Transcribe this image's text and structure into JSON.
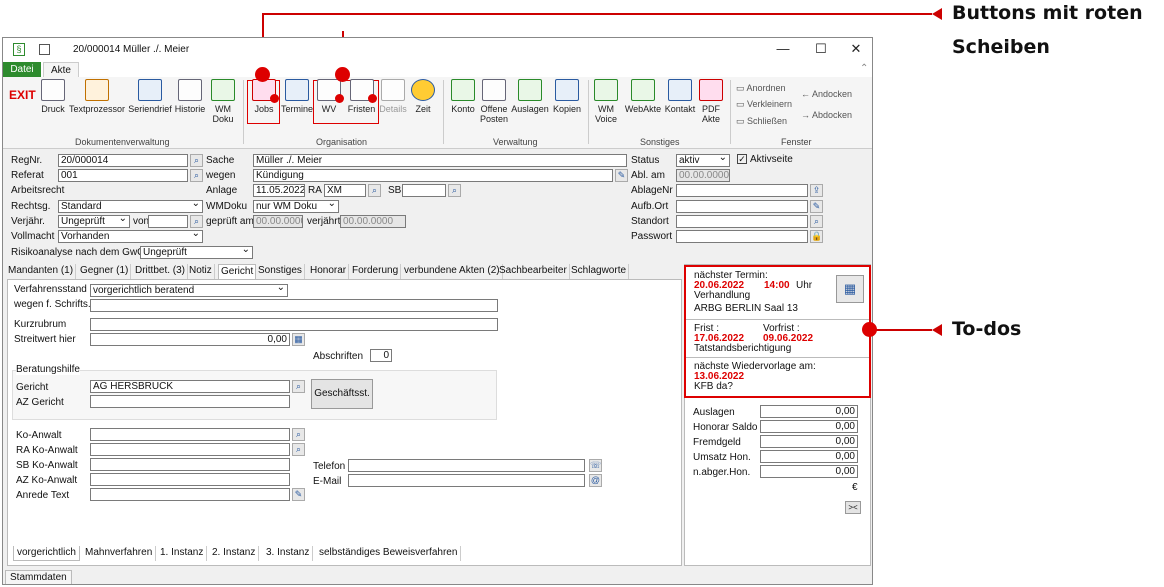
{
  "window": {
    "title": "20/000014 Müller ./. Meier",
    "minimize": "—",
    "maximize": "☐",
    "close": "✕",
    "collapse": "⌃"
  },
  "menu_tabs": {
    "datei": "Datei",
    "akte": "Akte"
  },
  "ribbon": {
    "exit": "EXIT",
    "buttons": [
      {
        "label": "Druck"
      },
      {
        "label": "Textprozessor"
      },
      {
        "label": "Seriendrief"
      },
      {
        "label": "Historie"
      },
      {
        "label": "WM\nDoku"
      },
      {
        "label": "Jobs"
      },
      {
        "label": "Termine"
      },
      {
        "label": "WV"
      },
      {
        "label": "Fristen"
      },
      {
        "label": "Details"
      },
      {
        "label": "Zeit"
      },
      {
        "label": "Konto"
      },
      {
        "label": "Offene\nPosten"
      },
      {
        "label": "Auslagen"
      },
      {
        "label": "Kopien"
      },
      {
        "label": "WM\nVoice"
      },
      {
        "label": "WebAkte"
      },
      {
        "label": "Kontakt"
      },
      {
        "label": "PDF\nAkte"
      }
    ],
    "groups": {
      "dokumentenverwaltung": "Dokumentenverwaltung",
      "organisation": "Organisation",
      "verwaltung": "Verwaltung",
      "sonstiges": "Sonstiges",
      "fenster": "Fenster"
    },
    "fenster": {
      "anordnen": "Anordnen",
      "verkleinern": "Verkleinern",
      "schliessen": "Schließen",
      "andocken": "Andocken",
      "abdocken": "Abdocken"
    }
  },
  "form": {
    "regnr_label": "RegNr.",
    "regnr": "20/000014",
    "referat_label": "Referat",
    "referat": "001",
    "arbeitsrecht_label": "Arbeitsrecht",
    "rechtsg_label": "Rechtsg.",
    "rechtsg": "Standard",
    "verjahr_label": "Verjähr.",
    "verjahr": "Ungeprüft",
    "von_label": "von",
    "vollmacht_label": "Vollmacht",
    "vollmacht": "Vorhanden",
    "risiko_label": "Risikoanalyse nach dem GwG",
    "risiko": "Ungeprüft",
    "sache_label": "Sache",
    "sache": "Müller ./. Meier",
    "wegen_label": "wegen",
    "wegen": "Kündigung",
    "anlage_label": "Anlage",
    "anlage": "11.05.2022",
    "ra_label": "RA",
    "ra": "XM",
    "sb_label": "SB",
    "wmdoku_label": "WMDoku",
    "wmdoku": "nur WM Doku",
    "gepruft_label": "geprüft am",
    "gepruft": "00.00.0000",
    "verjahrt_label": "verjährt",
    "verjahrt": "00.00.0000",
    "status_label": "Status",
    "status": "aktiv",
    "aktivseite": "Aktivseite",
    "ablam_label": "Abl. am",
    "ablam": "00.00.0000",
    "ablagenr_label": "AblageNr",
    "aufbort_label": "Aufb.Ort",
    "standort_label": "Standort",
    "passwort_label": "Passwort"
  },
  "tabs": [
    "Mandanten (1)",
    "Gegner (1)",
    "Drittbet. (3)",
    "Notiz",
    "Gericht",
    "Sonstiges",
    "Honorar",
    "Forderung",
    "verbundene Akten (2)",
    "Sachbearbeiter",
    "Schlagworte"
  ],
  "gericht": {
    "verfahrensstand_label": "Verfahrensstand",
    "verfahrensstand": "vorgerichtlich beratend",
    "wegen_label": "wegen f. Schrifts.",
    "kurzrubrum_label": "Kurzrubrum",
    "streitwert_label": "Streitwert hier",
    "streitwert": "0,00",
    "abschriften_label": "Abschriften",
    "abschriften": "0",
    "beratungshilfe_label": "Beratungshilfe",
    "gericht_label": "Gericht",
    "gericht": "AG HERSBRUCK",
    "az_label": "AZ Gericht",
    "geschaeft": "Geschäftsst.",
    "koanwalt_label": "Ko-Anwalt",
    "ra_ko_label": "RA Ko-Anwalt",
    "sb_ko_label": "SB Ko-Anwalt",
    "az_ko_label": "AZ Ko-Anwalt",
    "anrede_label": "Anrede Text",
    "telefon_label": "Telefon",
    "email_label": "E-Mail"
  },
  "bottom_tabs": [
    "vorgerichtlich",
    "Mahnverfahren",
    "1. Instanz",
    "2. Instanz",
    "3. Instanz",
    "selbständiges Beweisverfahren"
  ],
  "stammdaten": "Stammdaten",
  "todo": {
    "termin_label": "nächster Termin:",
    "termin_date": "20.06.2022",
    "termin_time": "14:00",
    "uhr": "Uhr",
    "termin_type": "Verhandlung",
    "termin_place": "ARBG BERLIN Saal 13",
    "frist_label": "Frist :",
    "frist": "17.06.2022",
    "vorfrist_label": "Vorfrist :",
    "vorfrist": "09.06.2022",
    "frist_text": "Tatstandsberichtigung",
    "wv_label": "nächste Wiedervorlage am:",
    "wv_date": "13.06.2022",
    "wv_text": "KFB da?"
  },
  "finance": [
    {
      "label": "Auslagen",
      "value": "0,00"
    },
    {
      "label": "Honorar Saldo",
      "value": "0,00"
    },
    {
      "label": "Fremdgeld",
      "value": "0,00"
    },
    {
      "label": "Umsatz Hon.",
      "value": "0,00"
    },
    {
      "label": "n.abger.Hon.",
      "value": "0,00"
    }
  ],
  "currency": "€",
  "collapse_btn": "><",
  "annotations": {
    "buttons_1": "Buttons mit roten",
    "buttons_2": "Scheiben",
    "todos": "To-dos"
  },
  "colors": {
    "accent_red": "#d00000",
    "ribbon_green": "#2e8b2e"
  }
}
